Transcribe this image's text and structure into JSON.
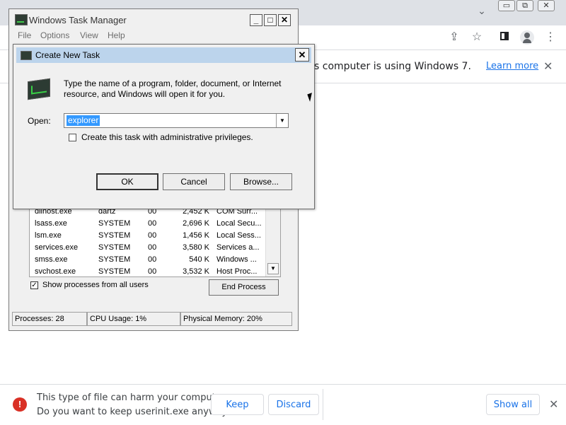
{
  "chrome": {
    "tab_caret": "⌄",
    "window_buttons": [
      "▭",
      "⧉",
      "✕"
    ],
    "toolbar_icons": [
      "share-icon",
      "star-icon",
      "sidebar-icon",
      "profile-icon",
      "menu-icon"
    ],
    "infobar": {
      "text": "s computer is using Windows 7.",
      "link": "Learn more",
      "close": "✕"
    }
  },
  "download_shelf": {
    "warning_line1": "This type of file can harm your computer.",
    "warning_line2": "Do you want to keep userinit.exe anyway?",
    "keep_label": "Keep",
    "discard_label": "Discard",
    "show_all_label": "Show all",
    "close": "✕",
    "warn_glyph": "!"
  },
  "task_manager": {
    "title": "Windows Task Manager",
    "controls": {
      "minimize": "_",
      "maximize": "□",
      "close": "✕"
    },
    "menu": [
      "File",
      "Options",
      "View",
      "Help"
    ],
    "processes": [
      {
        "name": "dllhost.exe",
        "user": "dartz",
        "cpu": "00",
        "mem": "2,452 K",
        "desc": "COM Surr..."
      },
      {
        "name": "lsass.exe",
        "user": "SYSTEM",
        "cpu": "00",
        "mem": "2,696 K",
        "desc": "Local Secu..."
      },
      {
        "name": "lsm.exe",
        "user": "SYSTEM",
        "cpu": "00",
        "mem": "1,456 K",
        "desc": "Local Sess..."
      },
      {
        "name": "services.exe",
        "user": "SYSTEM",
        "cpu": "00",
        "mem": "3,580 K",
        "desc": "Services a..."
      },
      {
        "name": "smss.exe",
        "user": "SYSTEM",
        "cpu": "00",
        "mem": "540 K",
        "desc": "Windows ..."
      },
      {
        "name": "svchost.exe",
        "user": "SYSTEM",
        "cpu": "00",
        "mem": "3,532 K",
        "desc": "Host Proc..."
      }
    ],
    "show_all_users_label": "Show processes from all users",
    "show_all_users_checked": true,
    "end_process_label": "End Process",
    "status": {
      "processes": "Processes: 28",
      "cpu": "CPU Usage: 1%",
      "memory": "Physical Memory: 20%"
    }
  },
  "create_task_dialog": {
    "title": "Create New Task",
    "close": "✕",
    "description": "Type the name of a program, folder, document, or Internet resource, and Windows will open it for you.",
    "open_label": "Open:",
    "open_value": "explorer",
    "admin_label": "Create this task with administrative privileges.",
    "admin_checked": false,
    "ok_label": "OK",
    "cancel_label": "Cancel",
    "browse_label": "Browse..."
  }
}
